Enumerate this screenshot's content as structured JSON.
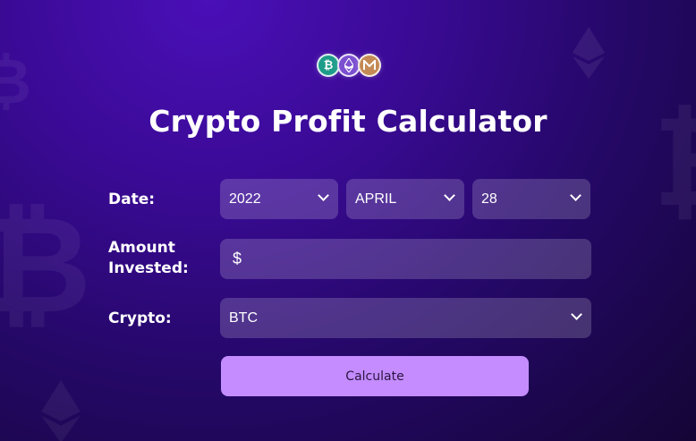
{
  "header": {
    "title": "Crypto Profit Calculator",
    "coins": [
      "bitcoin-coin-icon",
      "ethereum-coin-icon",
      "monero-coin-icon"
    ]
  },
  "form": {
    "date_label": "Date:",
    "year": "2022",
    "month": "APRIL",
    "day": "28",
    "amount_label_line1": "Amount",
    "amount_label_line2": "Invested:",
    "amount_prefix": "$",
    "amount_value": "",
    "crypto_label": "Crypto:",
    "crypto": "BTC",
    "calculate_label": "Calculate"
  },
  "colors": {
    "accent": "#c48cff",
    "background_top": "#4a0fb8",
    "background_bottom": "#140535",
    "field_bg": "rgba(255,255,255,0.18)"
  }
}
